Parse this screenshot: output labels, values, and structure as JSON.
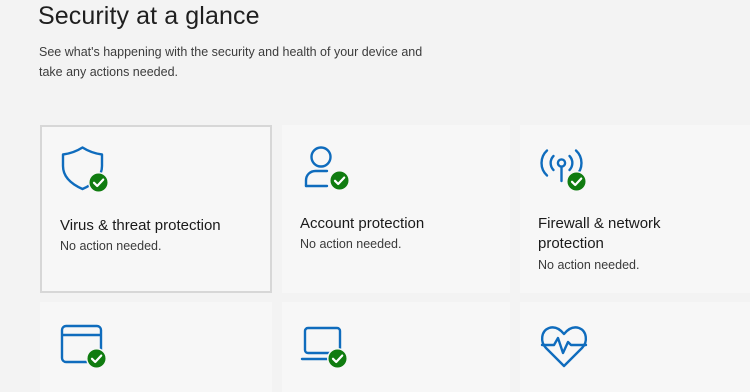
{
  "header": {
    "title": "Security at a glance",
    "subtitle": "See what's happening with the security and health of your device and take any actions needed."
  },
  "colors": {
    "icon_blue": "#0f6cbd",
    "status_green": "#107c10",
    "background": "#f3f3f3",
    "tile_background": "#f7f7f7"
  },
  "tiles": [
    {
      "icon": "shield-icon",
      "status_icon": "checkmark-badge-icon",
      "title": "Virus & threat protection",
      "status": "No action needed."
    },
    {
      "icon": "person-icon",
      "status_icon": "checkmark-badge-icon",
      "title": "Account protection",
      "status": "No action needed."
    },
    {
      "icon": "wireless-antenna-icon",
      "status_icon": "checkmark-badge-icon",
      "title": "Firewall & network protection",
      "status": "No action needed."
    },
    {
      "icon": "app-browser-window-icon",
      "status_icon": "checkmark-badge-icon"
    },
    {
      "icon": "laptop-icon",
      "status_icon": "checkmark-badge-icon"
    },
    {
      "icon": "heart-pulse-icon"
    }
  ]
}
